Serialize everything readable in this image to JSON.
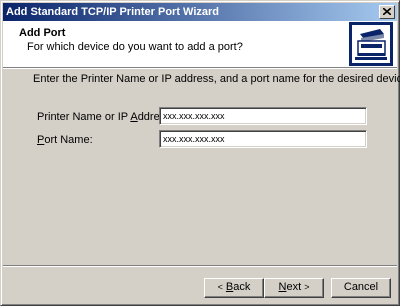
{
  "window": {
    "title": "Add Standard TCP/IP Printer Port Wizard",
    "close_icon": "close-icon"
  },
  "header": {
    "title": "Add Port",
    "subtitle": "For which device do you want to add a port?",
    "icon": "printer-network-icon"
  },
  "body": {
    "instructions": "Enter the Printer Name or IP address, and a port name for the desired device."
  },
  "fields": {
    "printer_name_label_pre": "Printer Name or IP ",
    "printer_name_label_mnemonic": "A",
    "printer_name_label_post": "ddress:",
    "printer_name_value": "xxx.xxx.xxx.xxx",
    "port_name_label_mnemonic": "P",
    "port_name_label_post": "ort Name:",
    "port_name_value": "xxx.xxx.xxx.xxx"
  },
  "buttons": {
    "back_arrow": "<",
    "back_mnemonic": "B",
    "back_rest": "ack",
    "next_mnemonic": "N",
    "next_rest": "ext",
    "next_arrow": ">",
    "cancel": "Cancel"
  }
}
